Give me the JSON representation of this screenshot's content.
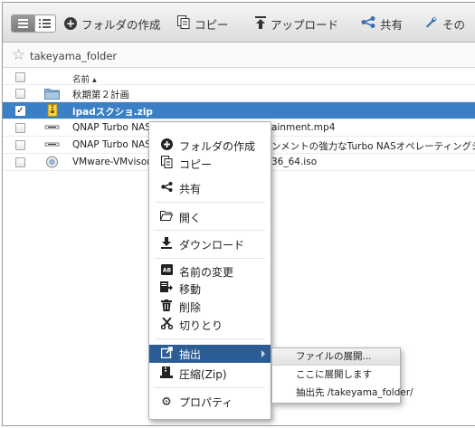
{
  "toolbar": {
    "create_folder": "フォルダの作成",
    "copy": "コピー",
    "upload": "アップロード",
    "share": "共有",
    "more": "その"
  },
  "path": {
    "folder": "takeyama_folder"
  },
  "list": {
    "header_name": "名前",
    "rows": [
      {
        "name": "秋期第２計画",
        "icon": "folder-icon",
        "selected": false,
        "tail": ""
      },
      {
        "name": "ipadスクショ.zip",
        "icon": "zip-file-icon",
        "selected": true,
        "tail": ""
      },
      {
        "name": "QNAP Turbo NAS",
        "icon": "video-file-icon",
        "selected": false,
        "tail": "ainment.mp4"
      },
      {
        "name": "QNAP Turbo NAS",
        "icon": "video-file-icon",
        "selected": false,
        "tail": "ンメントの強力なTurbo NASオペレーティングシ"
      },
      {
        "name": "VMware-VMvisor",
        "icon": "disc-image-icon",
        "selected": false,
        "tail": "36_64.iso"
      }
    ]
  },
  "context_menu": {
    "create_folder": "フォルダの作成",
    "copy": "コピー",
    "share": "共有",
    "open": "開く",
    "download": "ダウンロード",
    "rename": "名前の変更",
    "move": "移動",
    "delete": "削除",
    "cut": "切りとり",
    "extract": "抽出",
    "compress": "圧縮(Zip)",
    "properties": "プロパティ"
  },
  "submenu": {
    "extract_files": "ファイルの展開...",
    "extract_here": "ここに展開します",
    "extract_to": "抽出先 /takeyama_folder/"
  },
  "colors": {
    "selection": "#3b7fc4",
    "menu_highlight": "#2b5c93"
  }
}
